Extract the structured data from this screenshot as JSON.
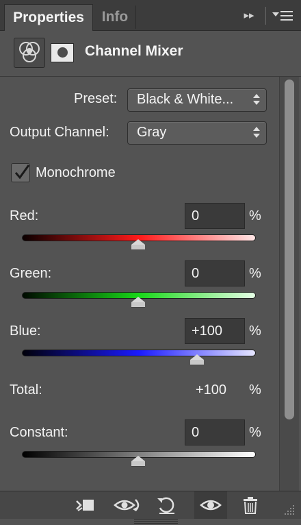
{
  "tabs": [
    {
      "label": "Properties",
      "active": true
    },
    {
      "label": "Info",
      "active": false
    }
  ],
  "header": {
    "title": "Channel Mixer",
    "icons": [
      "channel-mixer-adjustment-icon",
      "layer-mask-icon"
    ]
  },
  "preset": {
    "label": "Preset:",
    "value": "Black & White..."
  },
  "output_channel": {
    "label": "Output Channel:",
    "value": "Gray"
  },
  "monochrome": {
    "label": "Monochrome",
    "checked": true
  },
  "channels": [
    {
      "label": "Red:",
      "value": "0",
      "unit": "%",
      "slider_percent": 0,
      "color": "#ff2020"
    },
    {
      "label": "Green:",
      "value": "0",
      "unit": "%",
      "slider_percent": 0,
      "color": "#20d020"
    },
    {
      "label": "Blue:",
      "value": "+100",
      "unit": "%",
      "slider_percent": 100,
      "color": "#3030ff"
    }
  ],
  "total": {
    "label": "Total:",
    "value": "+100",
    "unit": "%"
  },
  "constant": {
    "label": "Constant:",
    "value": "0",
    "unit": "%",
    "slider_percent": 0
  },
  "toolbar_icons": [
    "clip-to-layer-icon",
    "view-previous-state-icon",
    "reset-icon",
    "toggle-visibility-icon",
    "delete-icon"
  ],
  "colors": {
    "panel_bg": "#535353",
    "tabbar_bg": "#3c3c3c",
    "field_bg": "#3a3a3a",
    "scroll_thumb": "#8e8e8e"
  }
}
